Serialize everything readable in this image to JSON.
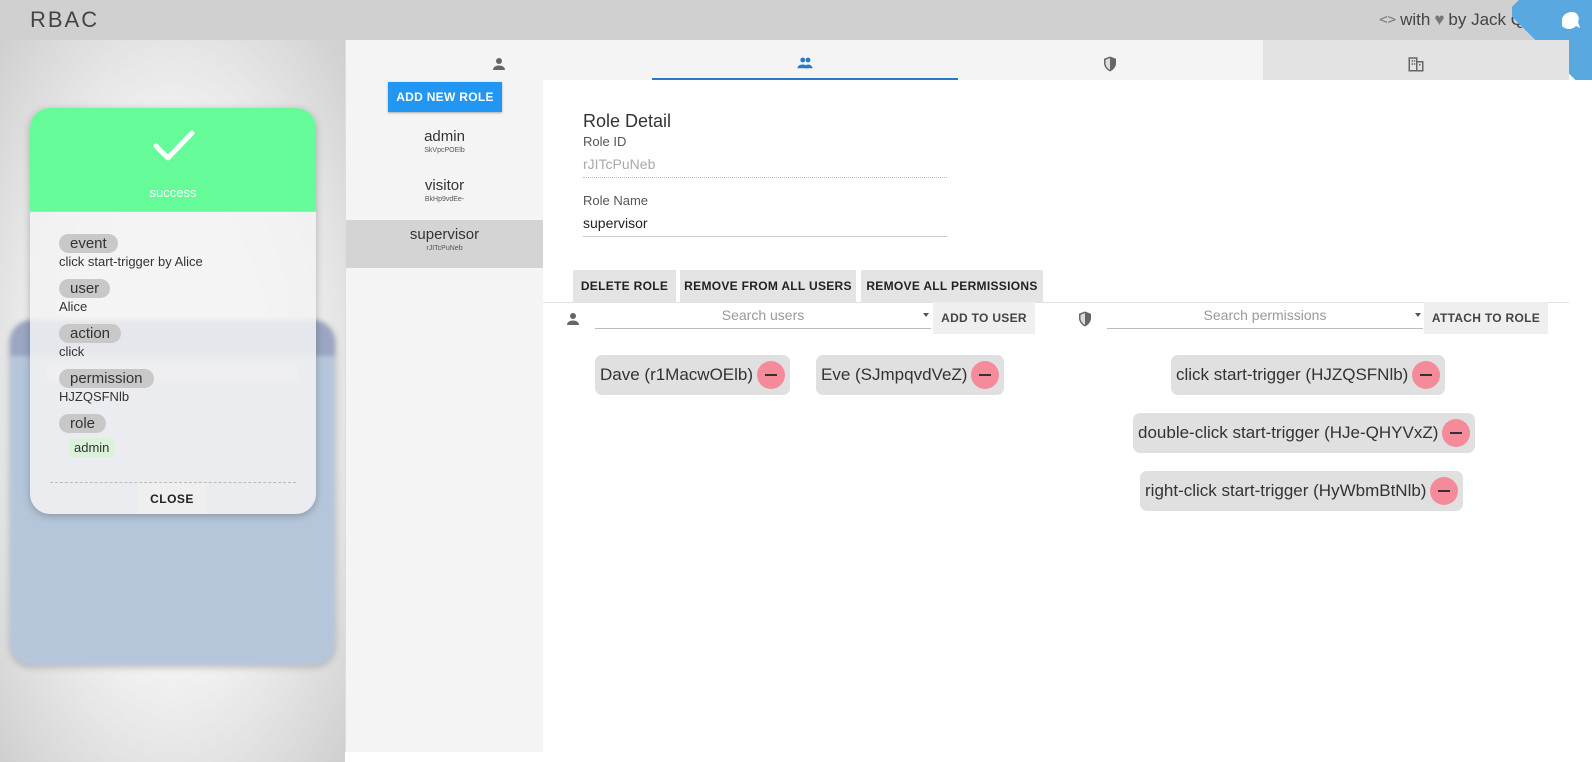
{
  "header": {
    "title": "RBAC",
    "credit_with": "with",
    "credit_by": "by Jack Q"
  },
  "tabs": [
    {
      "icon": "user-icon"
    },
    {
      "icon": "group-icon",
      "active": true
    },
    {
      "icon": "shield-icon"
    },
    {
      "icon": "building-icon"
    }
  ],
  "role_list": {
    "add_button": "ADD NEW ROLE",
    "items": [
      {
        "name": "admin",
        "id": "SkVpcPOElb"
      },
      {
        "name": "visitor",
        "id": "BkHp9vdEe-"
      },
      {
        "name": "supervisor",
        "id": "rJITcPuNeb",
        "selected": true
      }
    ]
  },
  "detail": {
    "title": "Role Detail",
    "role_id_label": "Role ID",
    "role_id_value": "rJITcPuNeb",
    "role_name_label": "Role Name",
    "role_name_value": "supervisor",
    "actions": {
      "delete": "DELETE ROLE",
      "remove_users": "REMOVE FROM ALL USERS",
      "remove_perms": "REMOVE ALL PERMISSIONS"
    },
    "users": {
      "search_placeholder": "Search users",
      "add_button": "ADD TO USER",
      "chips": [
        "Dave (r1MacwOElb)",
        "Eve (SJmpqvdVeZ)"
      ]
    },
    "permissions": {
      "search_placeholder": "Search permissions",
      "attach_button": "ATTACH TO ROLE",
      "chips": [
        "click start-trigger (HJZQSFNlb)",
        "double-click start-trigger (HJe-QHYVxZ)",
        "right-click start-trigger (HyWbmBtNlb)"
      ]
    }
  },
  "modal": {
    "status": "success",
    "fields": {
      "event_label": "event",
      "event_value": "click start-trigger by Alice",
      "user_label": "user",
      "user_value": "Alice",
      "action_label": "action",
      "action_value": "click",
      "permission_label": "permission",
      "permission_value": "HJZQSFNlb",
      "role_label": "role",
      "role_value": "admin"
    },
    "close_button": "CLOSE",
    "accent_color": "#66fb99"
  },
  "colors": {
    "primary": "#2196f3",
    "tab_indicator": "#2979c9",
    "remove": "#f48a9a"
  }
}
